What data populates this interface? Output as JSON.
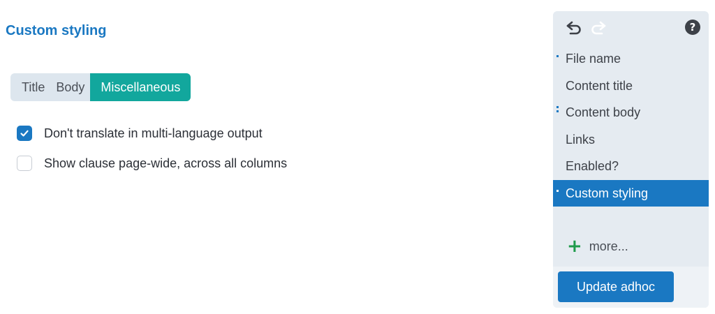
{
  "main": {
    "title": "Custom styling",
    "tabs": [
      {
        "label": "Title",
        "active": false
      },
      {
        "label": "Body",
        "active": false
      },
      {
        "label": "Miscellaneous",
        "active": true
      }
    ],
    "options": [
      {
        "label": "Don't translate in multi-language output",
        "checked": true
      },
      {
        "label": "Show clause page-wide, across all columns",
        "checked": false
      }
    ]
  },
  "panel": {
    "toolbar": {
      "undo_icon": "undo-icon",
      "redo_icon": "redo-icon",
      "help_icon": "help-icon",
      "help_glyph": "?"
    },
    "items": [
      {
        "label": "File name",
        "marker": "single"
      },
      {
        "label": "Content title",
        "marker": "none"
      },
      {
        "label": "Content body",
        "marker": "double"
      },
      {
        "label": "Links",
        "marker": "none"
      },
      {
        "label": "Enabled?",
        "marker": "none"
      },
      {
        "label": "Custom styling",
        "marker": "single",
        "active": true
      }
    ],
    "more_symbol": "+",
    "more_label": "more...",
    "update_button": "Update adhoc"
  },
  "colors": {
    "accent": "#1a78c2",
    "tab_active": "#12a79d",
    "add_icon": "#1e9b4b",
    "panel_bg": "#e5ebf1"
  }
}
